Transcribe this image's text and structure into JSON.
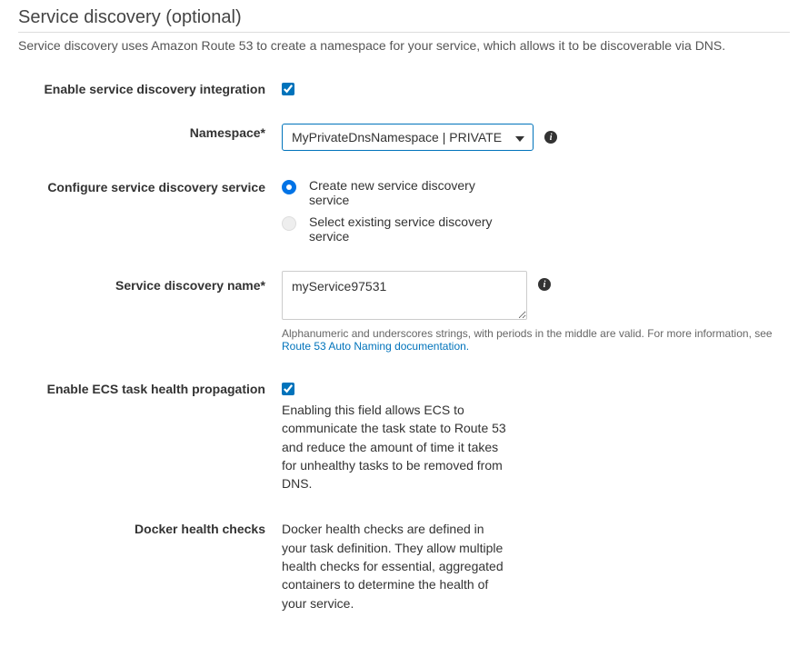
{
  "section": {
    "title": "Service discovery (optional)",
    "description": "Service discovery uses Amazon Route 53 to create a namespace for your service, which allows it to be discoverable via DNS."
  },
  "enable_integration": {
    "label": "Enable service discovery integration",
    "checked": true
  },
  "namespace": {
    "label": "Namespace*",
    "selected": "MyPrivateDnsNamespace | PRIVATE"
  },
  "configure_service": {
    "label": "Configure service discovery service",
    "options": [
      {
        "label": "Create new service discovery service",
        "selected": true
      },
      {
        "label": "Select existing service discovery service",
        "selected": false
      }
    ]
  },
  "discovery_name": {
    "label": "Service discovery name*",
    "value": "myService97531",
    "help_prefix": "Alphanumeric and underscores strings, with periods in the middle are valid. For more information, see ",
    "help_link": "Route 53 Auto Naming documentation."
  },
  "health_propagation": {
    "label": "Enable ECS task health propagation",
    "checked": true,
    "description": "Enabling this field allows ECS to communicate the task state to Route 53 and reduce the amount of time it takes for unhealthy tasks to be removed from DNS."
  },
  "docker_health": {
    "label": "Docker health checks",
    "description": "Docker health checks are defined in your task definition. They allow multiple health checks for essential, aggregated containers to determine the health of your service."
  }
}
